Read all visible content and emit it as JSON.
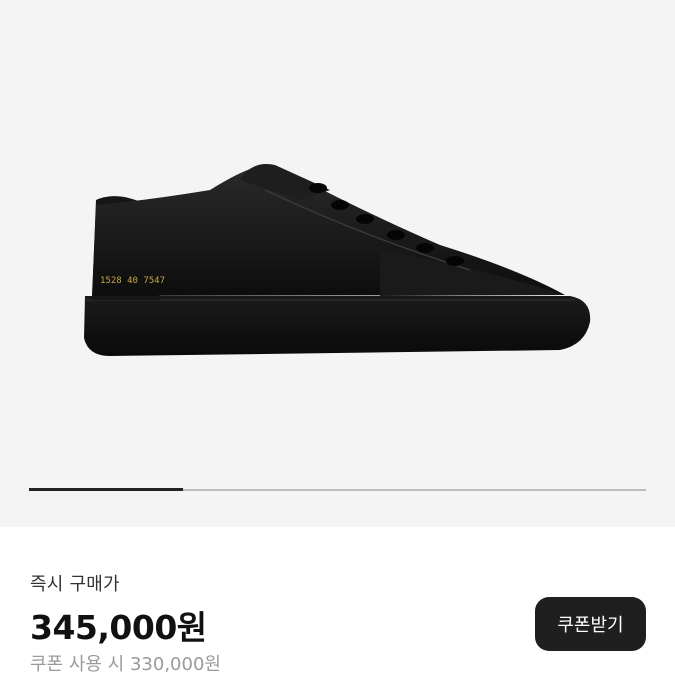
{
  "product": {
    "image_alt": "black leather low-top sneaker",
    "serial_stamp": "1528 40 7547",
    "carousel_progress": 0.25
  },
  "purchase": {
    "label": "즉시 구매가",
    "price": "345,000원",
    "coupon_price": "쿠폰 사용 시 330,000원",
    "coupon_button": "쿠폰받기"
  }
}
